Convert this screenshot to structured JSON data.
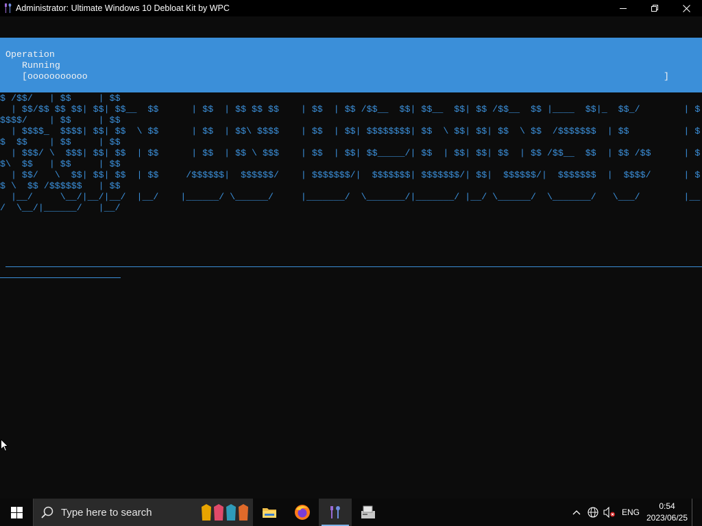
{
  "window": {
    "title": "Administrator:  Ultimate Windows 10 Debloat Kit by WPC",
    "controls": [
      "minimize-icon",
      "restore-icon",
      "close-icon"
    ]
  },
  "progress": {
    "line1": "Operation",
    "line2": "Running",
    "bar": "[ooooooooooo",
    "bar_end": "]",
    "panel_color": "#3b8fd9"
  },
  "ascii_banner": "$ /$$/   | $$     | $$\n  | $$/$$ $$ $$| $$| $$__  $$      | $$  | $$ $$ $$    | $$  | $$ /$$__  $$| $$__  $$| $$ /$$__  $$ |____  $$|_  $$_/        | $\n$$$$/    | $$     | $$\n  | $$$$_  $$$$| $$| $$  \\ $$      | $$  | $$\\ $$$$    | $$  | $$| $$$$$$$$| $$  \\ $$| $$| $$  \\ $$  /$$$$$$$  | $$          | $\n$  $$    | $$     | $$\n  | $$$/ \\  $$$| $$| $$  | $$      | $$  | $$ \\ $$$    | $$  | $$| $$_____/| $$  | $$| $$| $$  | $$ /$$__  $$  | $$ /$$      | $\n$\\  $$   | $$     | $$\n  | $$/   \\  $$| $$| $$  | $$     /$$$$$$|  $$$$$$/    | $$$$$$$/|  $$$$$$$| $$$$$$$/| $$|  $$$$$$/|  $$$$$$$  |  $$$$/      | $\n$ \\  $$ /$$$$$$   | $$\n  |__/     \\__/|__/|__/  |__/    |______/ \\______/     |_______/  \\_______/|_______/ |__/ \\______/  \\_______/   \\___/        |__\n/  \\__/|______/   |__/",
  "taskbar": {
    "search_placeholder": "Type here to search",
    "apps": [
      {
        "name": "file-explorer",
        "active": false
      },
      {
        "name": "firefox",
        "active": false
      },
      {
        "name": "debloat-kit",
        "active": true
      },
      {
        "name": "setup-app",
        "active": false
      }
    ],
    "language": "ENG",
    "time": "0:54",
    "date": "2023/06/25"
  },
  "colors": {
    "console_bg": "#0c0c0c",
    "accent": "#3b8fd9",
    "titlebar": "#000000",
    "taskbar": "#0a0a0a"
  }
}
